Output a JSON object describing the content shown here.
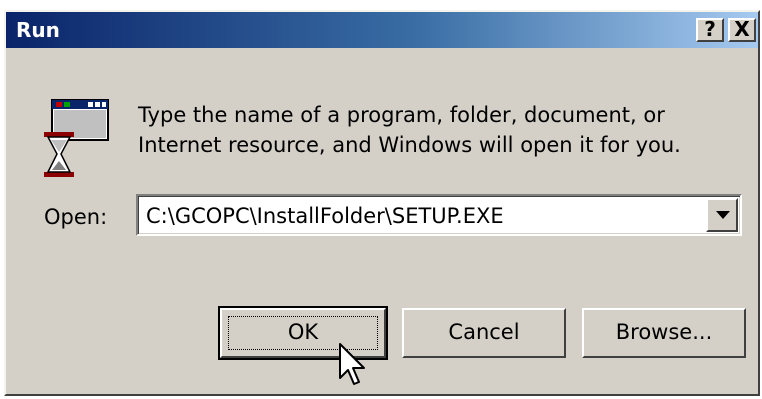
{
  "window": {
    "title": "Run",
    "help_label": "?",
    "close_label": "X"
  },
  "message": {
    "line1": "Type the name of a program, folder, document, or",
    "line2": "Internet resource, and Windows will open it for you."
  },
  "open": {
    "label": "Open:",
    "value": "C:\\GCOPC\\InstallFolder\\SETUP.EXE"
  },
  "buttons": {
    "ok": "OK",
    "cancel": "Cancel",
    "browse": "Browse..."
  },
  "icons": {
    "run": "run-program-icon",
    "dropdown": "chevron-down-icon",
    "cursor": "mouse-pointer-icon"
  },
  "colors": {
    "title_gradient_start": "#0a246a",
    "title_gradient_end": "#a6caf0",
    "dialog_face": "#d4d0c8"
  }
}
